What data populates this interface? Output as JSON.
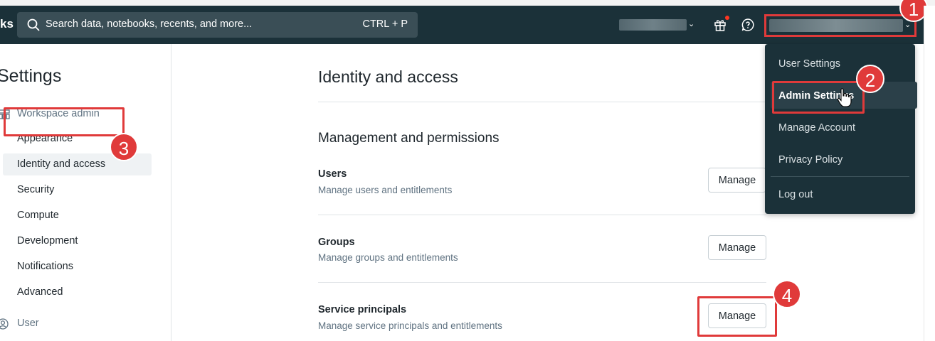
{
  "header": {
    "brand_tail": "ks",
    "search_placeholder": "Search data, notebooks, recents, and more...",
    "search_shortcut": "CTRL + P",
    "workspace_caret": "⌄",
    "user_caret": "⌄"
  },
  "sidebar": {
    "title": "Settings",
    "section": "Workspace admin",
    "items": [
      {
        "label": "Appearance"
      },
      {
        "label": "Identity and access"
      },
      {
        "label": "Security"
      },
      {
        "label": "Compute"
      },
      {
        "label": "Development"
      },
      {
        "label": "Notifications"
      },
      {
        "label": "Advanced"
      }
    ],
    "user_section": "User"
  },
  "main": {
    "title": "Identity and access",
    "section_title": "Management and permissions",
    "rows": [
      {
        "title": "Users",
        "desc": "Manage users and entitlements",
        "button": "Manage"
      },
      {
        "title": "Groups",
        "desc": "Manage groups and entitlements",
        "button": "Manage"
      },
      {
        "title": "Service principals",
        "desc": "Manage service principals and entitlements",
        "button": "Manage"
      }
    ]
  },
  "dropdown": {
    "items": [
      {
        "label": "User Settings"
      },
      {
        "label": "Admin Settings"
      },
      {
        "label": "Manage Account"
      },
      {
        "label": "Privacy Policy"
      },
      {
        "label": "Log out"
      }
    ]
  },
  "annotations": {
    "steps": [
      "1",
      "2",
      "3",
      "4"
    ],
    "highlight_color": "#e03a3a"
  },
  "colors": {
    "header_bg": "#1b3139",
    "notification_dot": "#ff3621"
  }
}
